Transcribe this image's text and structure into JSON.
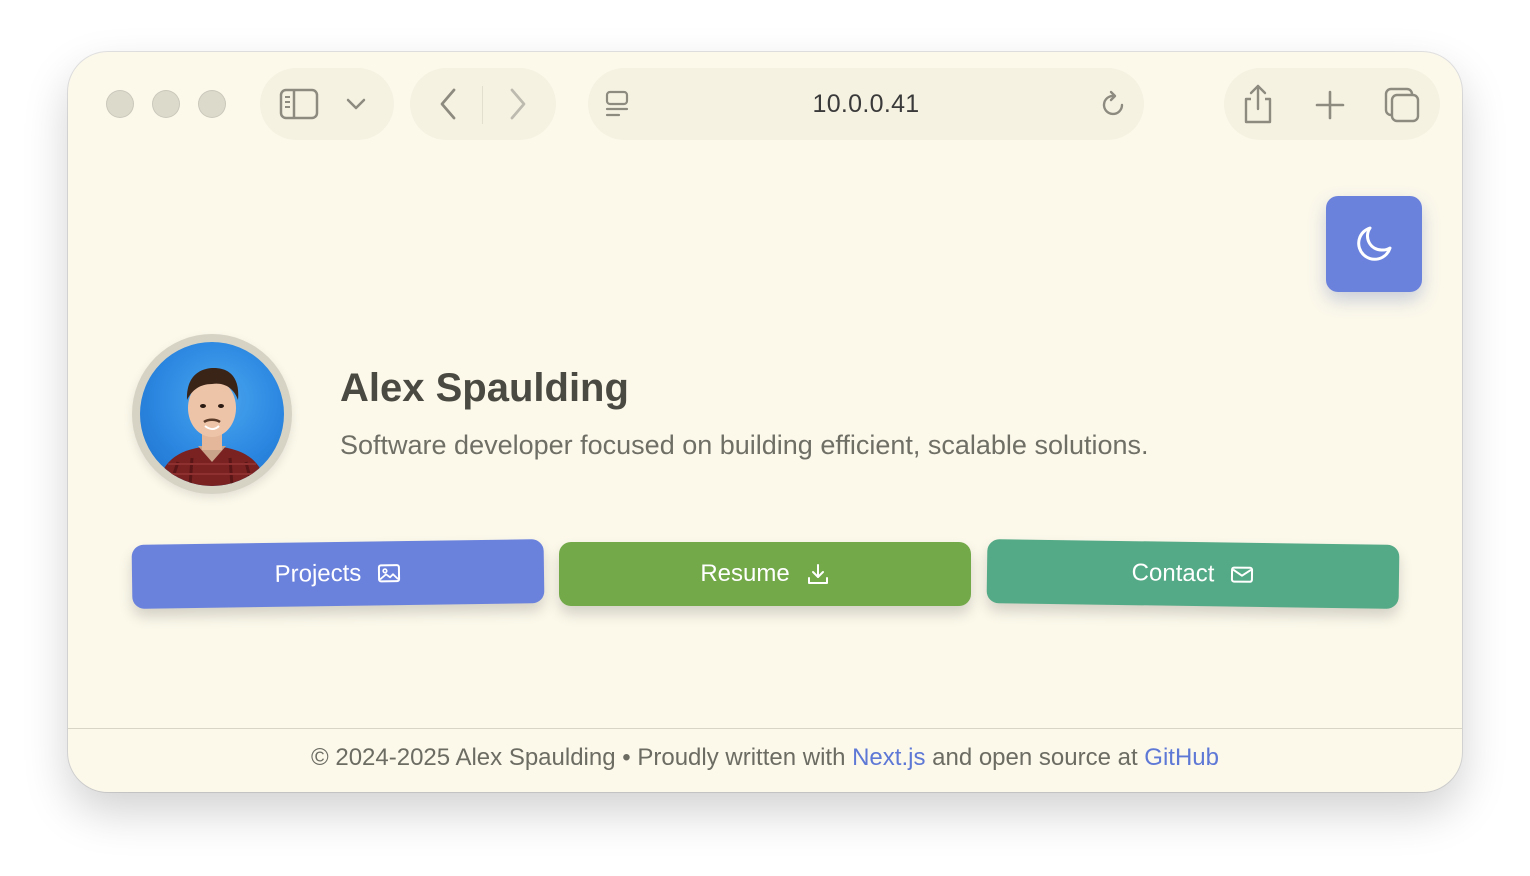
{
  "browser": {
    "url": "10.0.0.41",
    "icons": {
      "sidebar": "sidebar-icon",
      "chevron": "chevron-down-icon",
      "back": "back-arrow-icon",
      "forward": "forward-arrow-icon",
      "page_menu": "page-menu-icon",
      "reload": "reload-icon",
      "share": "share-icon",
      "new_tab": "plus-icon",
      "tabs": "tab-overview-icon"
    }
  },
  "theme_toggle": {
    "icon": "moon-icon",
    "color": "#6b82dd"
  },
  "profile": {
    "name": "Alex Spaulding",
    "tagline": "Software developer focused on building efficient, scalable solutions."
  },
  "actions": [
    {
      "label": "Projects",
      "icon": "image-icon",
      "color": "#6b82dd"
    },
    {
      "label": "Resume",
      "icon": "download-icon",
      "color": "#73a949"
    },
    {
      "label": "Contact",
      "icon": "mail-icon",
      "color": "#54aa86"
    }
  ],
  "footer": {
    "copyright": "© 2024-2025 Alex Spaulding",
    "separator": "•",
    "written_with": "Proudly written with",
    "nextjs": "Next.js",
    "open_source": "and open source at",
    "github": "GitHub",
    "link_color": "#5e78d6"
  }
}
